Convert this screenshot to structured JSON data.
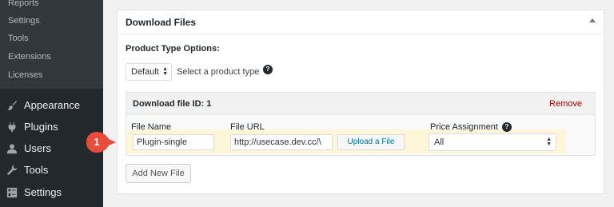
{
  "sidebar": {
    "submenu": [
      "Reports",
      "Settings",
      "Tools",
      "Extensions",
      "Licenses"
    ],
    "menu": [
      {
        "label": "Appearance",
        "icon": "paintbrush-icon"
      },
      {
        "label": "Plugins",
        "icon": "plugin-icon"
      },
      {
        "label": "Users",
        "icon": "users-icon"
      },
      {
        "label": "Tools",
        "icon": "wrench-icon"
      },
      {
        "label": "Settings",
        "icon": "settings-icon"
      }
    ]
  },
  "metabox": {
    "title": "Download Files",
    "product_type_label": "Product Type Options:",
    "product_type_value": "Default",
    "product_type_hint": "Select a product type",
    "file": {
      "header": "Download file ID: 1",
      "remove_label": "Remove",
      "file_name_label": "File Name",
      "file_name_value": "Plugin-single",
      "file_url_label": "File URL",
      "file_url_value": "http://usecase.dev.cc/\\",
      "upload_label": "Upload a File",
      "price_label": "Price Assignment",
      "price_value": "All"
    },
    "add_new_label": "Add New File"
  },
  "callout": {
    "number": "1",
    "color": "#e94b3c"
  },
  "colors": {
    "sidebar_bg": "#23282d",
    "submenu_bg": "#32373c",
    "link": "#0073aa",
    "remove": "#a00000",
    "row_highlight": "#fdf6d8"
  }
}
